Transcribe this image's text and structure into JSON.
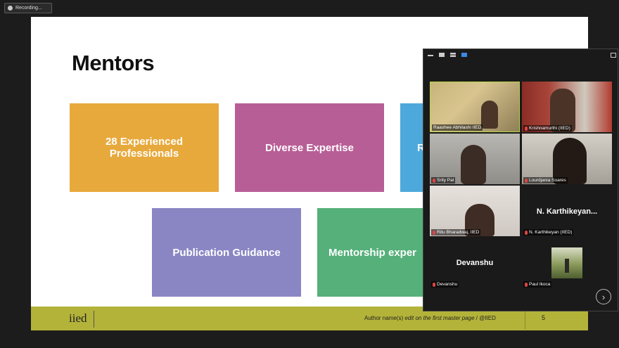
{
  "recording": {
    "label": "Recording..."
  },
  "slide": {
    "title": "Mentors",
    "boxes": [
      {
        "label": "28  Experienced Professionals",
        "color": "#e8a93c"
      },
      {
        "label": "Diverse Expertise",
        "color": "#b85e96"
      },
      {
        "label": "R",
        "color": "#4da9db"
      },
      {
        "label": "Publication Guidance",
        "color": "#8a86c4"
      },
      {
        "label": "Mentorship exper",
        "color": "#55b07a"
      }
    ],
    "footer": {
      "logo": "iied",
      "author_prefix": "Author name(s) ",
      "author_italic": "edit on the first master page",
      "author_suffix": " / @IIED",
      "page_number": "5",
      "bar_color": "#b3b33a"
    }
  },
  "meeting_panel": {
    "toolbar_icons": [
      "minimize-icon",
      "speaker-view-icon",
      "gallery-view-icon",
      "grid-view-icon",
      "exit-fullscreen-icon"
    ],
    "participants": [
      {
        "name": "Raashee Abhilashi IIED",
        "muted": false,
        "active": true,
        "show_video": true
      },
      {
        "name": "Krishnamurthi (IIED)",
        "muted": true,
        "show_video": true
      },
      {
        "name": "Srity Pal",
        "muted": true,
        "show_video": true
      },
      {
        "name": "Lourdjania Soares",
        "muted": true,
        "show_video": true
      },
      {
        "name": "Ritu Bharadwaj, IIED",
        "muted": true,
        "show_video": true
      },
      {
        "name": "N. Karthikeyan (IIED)",
        "display": "N. Karthikeyan...",
        "muted": true,
        "show_video": false
      },
      {
        "name": "Devanshu",
        "display": "Devanshu",
        "muted": true,
        "show_video": false
      },
      {
        "name": "Paul Ikoca",
        "muted": true,
        "show_video": true
      }
    ],
    "next_page_icon": "chevron-right-icon"
  }
}
